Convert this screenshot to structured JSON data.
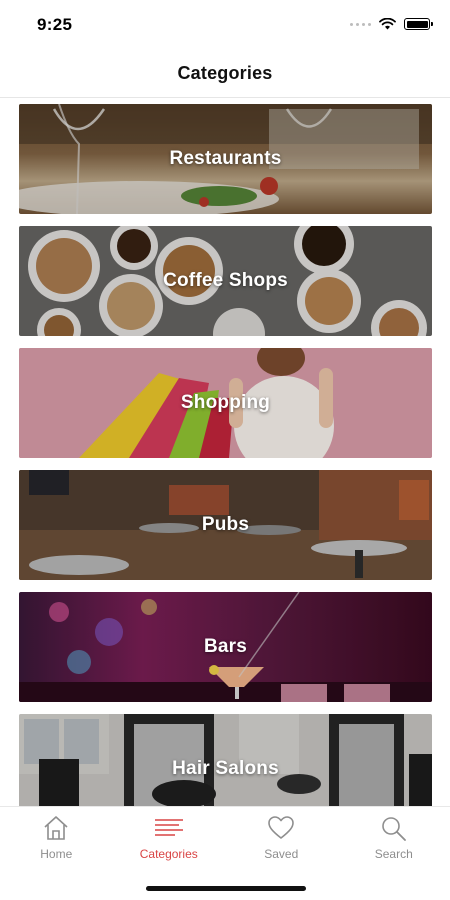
{
  "status_bar": {
    "time": "9:25"
  },
  "header": {
    "title": "Categories"
  },
  "categories": [
    {
      "label": "Restaurants"
    },
    {
      "label": "Coffee Shops"
    },
    {
      "label": "Shopping"
    },
    {
      "label": "Pubs"
    },
    {
      "label": "Bars"
    },
    {
      "label": "Hair Salons"
    }
  ],
  "tab_bar": {
    "active_color": "#d94545",
    "inactive_color": "#8e8e8e",
    "tabs": [
      {
        "label": "Home",
        "icon": "home-icon"
      },
      {
        "label": "Categories",
        "icon": "categories-icon",
        "active": true
      },
      {
        "label": "Saved",
        "icon": "heart-icon"
      },
      {
        "label": "Search",
        "icon": "search-icon"
      }
    ]
  }
}
